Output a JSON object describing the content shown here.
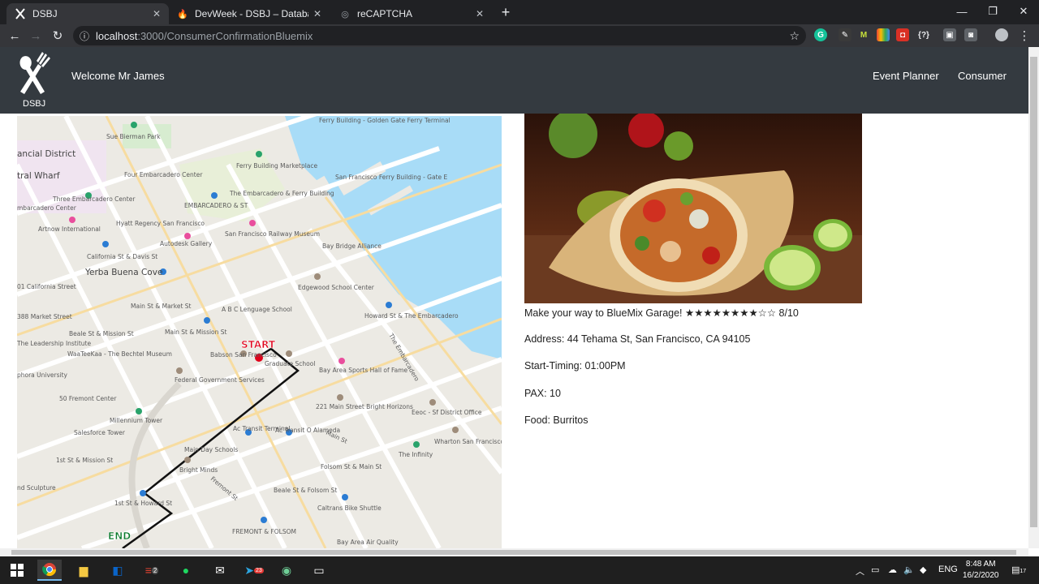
{
  "browser": {
    "tabs": [
      {
        "title": "DSBJ",
        "active": true,
        "icon": "dsbj-favicon"
      },
      {
        "title": "DevWeek - DSBJ – Database – Fi",
        "active": false,
        "icon": "firebase-favicon"
      },
      {
        "title": "reCAPTCHA",
        "active": false,
        "icon": "globe-favicon"
      }
    ],
    "url_host": "localhost",
    "url_path": ":3000/ConsumerConfirmationBluemix"
  },
  "header": {
    "logo_text": "DSBJ",
    "welcome": "Welcome Mr James",
    "nav": [
      {
        "label": "Event Planner"
      },
      {
        "label": "Consumer"
      }
    ]
  },
  "map": {
    "start_label": "START",
    "end_label": "END",
    "place_labels": [
      "Sue Bierman Park",
      "ancial District",
      "tral Wharf",
      "Four Embarcadero Center",
      "Three Embarcadero Center",
      "mbarcadero Center",
      "Hyatt Regency San Francisco",
      "Artnow International",
      "Ferry Building Marketplace",
      "The Embarcadero & Ferry Building",
      "EMBARCADERO & ST",
      "San Francisco Railway Museum",
      "Autodesk Gallery",
      "San Francisco Ferry Building - Gate E",
      "Ferry Building - Golden Gate Ferry Terminal",
      "California St & Davis St",
      "Yerba Buena Cove",
      "01 California Street",
      "Bay Bridge Alliance",
      "Edgewood School Center",
      "Main St & Market St",
      "A B C Lenguage School",
      "Howard St & The Embarcadero",
      "388 Market Street",
      "Beale St & Mission St",
      "Main St & Mission St",
      "The Leadership Institute",
      "WaaTeeKaa - The Bechtel Museum",
      "Babson San Francisco",
      "Graduate School",
      "Bay Area Sports Hall of Fame",
      "phora University",
      "Federal Government Services",
      "50 Fremont Center",
      "221 Main Street Bright Horizons",
      "Eeoc - Sf District Office",
      "Millennium Tower",
      "Salesforce Tower",
      "Ac Transit Terminal",
      "Ac Transit O Alameda",
      "Wharton San Francisco",
      "The Infinity",
      "Main Day Schools",
      "Bright Minds",
      "1st St & Mission St",
      "Folsom St & Main St",
      "Beale St & Folsom St",
      "1st St & Howard St",
      "Caltrans Bike Shuttle",
      "FREMONT & FOLSOM",
      "Bay Area Air Quality",
      "nd Sculpture",
      "The Embarcadero",
      "Main St",
      "Fremont St"
    ]
  },
  "event": {
    "headline": "Make your way to BlueMix Garage! ★★★★★★★★☆☆ 8/10",
    "rating": 8,
    "rating_max": 10,
    "address": "Address: 44 Tehama St, San Francisco, CA 94105",
    "timing": "Start-Timing: 01:00PM",
    "pax": "PAX: 10",
    "food": "Food: Burritos"
  },
  "taskbar": {
    "lang": "ENG",
    "time": "8:48 AM",
    "date": "16/2/2020",
    "notifications": "17",
    "todoist_badge": "2",
    "telegram_badge": "23"
  },
  "colors": {
    "header_bg": "#343a40",
    "chrome_bg": "#202124",
    "start_marker": "#e0001a",
    "end_label": "#0a7a2c",
    "water": "#9fd8f5"
  }
}
